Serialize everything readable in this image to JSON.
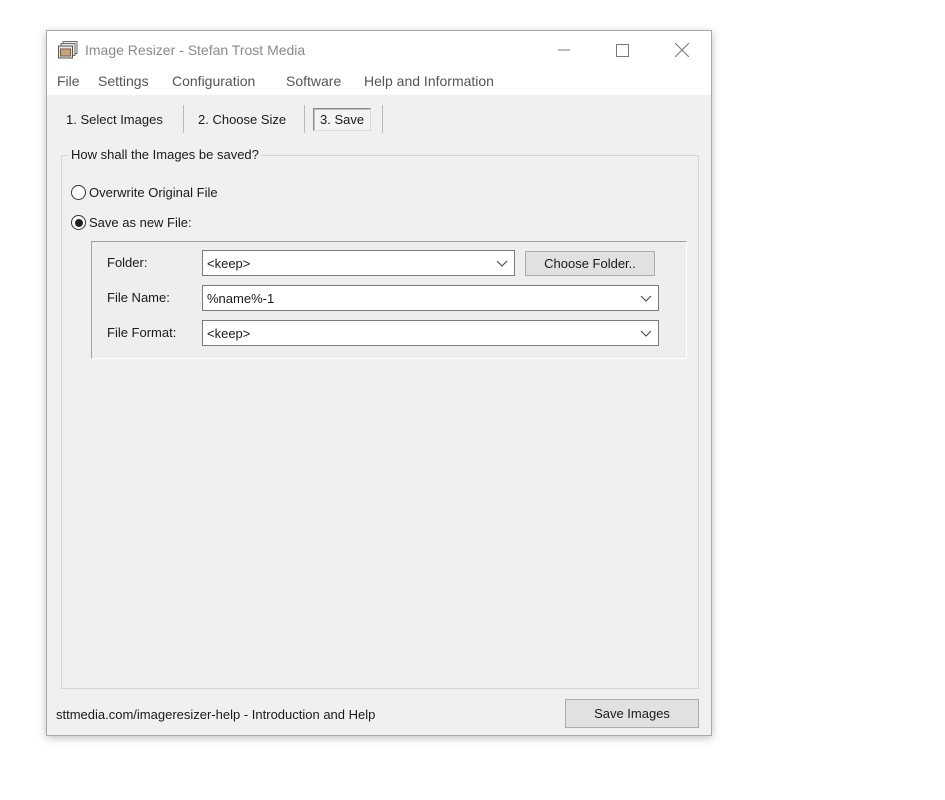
{
  "window": {
    "title": "Image Resizer - Stefan Trost Media",
    "icons": {
      "app": "app-windows-icon",
      "minimize": "minimize-icon",
      "maximize": "maximize-icon",
      "close": "close-icon"
    }
  },
  "menu": [
    "File",
    "Settings",
    "Configuration",
    "Software",
    "Help and Information"
  ],
  "tabs": [
    {
      "label": "1. Select Images",
      "active": false
    },
    {
      "label": "2. Choose Size",
      "active": false
    },
    {
      "label": "3. Save",
      "active": true
    }
  ],
  "save_group": {
    "title": "How shall the Images be saved?",
    "options": [
      {
        "label": "Overwrite Original File",
        "selected": false
      },
      {
        "label": "Save as new File:",
        "selected": true
      }
    ],
    "fields": {
      "folder": {
        "label": "Folder:",
        "value": "<keep>"
      },
      "file_name": {
        "label": "File Name:",
        "value": "%name%-1"
      },
      "file_format": {
        "label": "File Format:",
        "value": "<keep>"
      }
    },
    "choose_folder_label": "Choose Folder.."
  },
  "footer": {
    "help_link": "sttmedia.com/imageresizer-help - Introduction and Help",
    "save_button": "Save Images"
  }
}
